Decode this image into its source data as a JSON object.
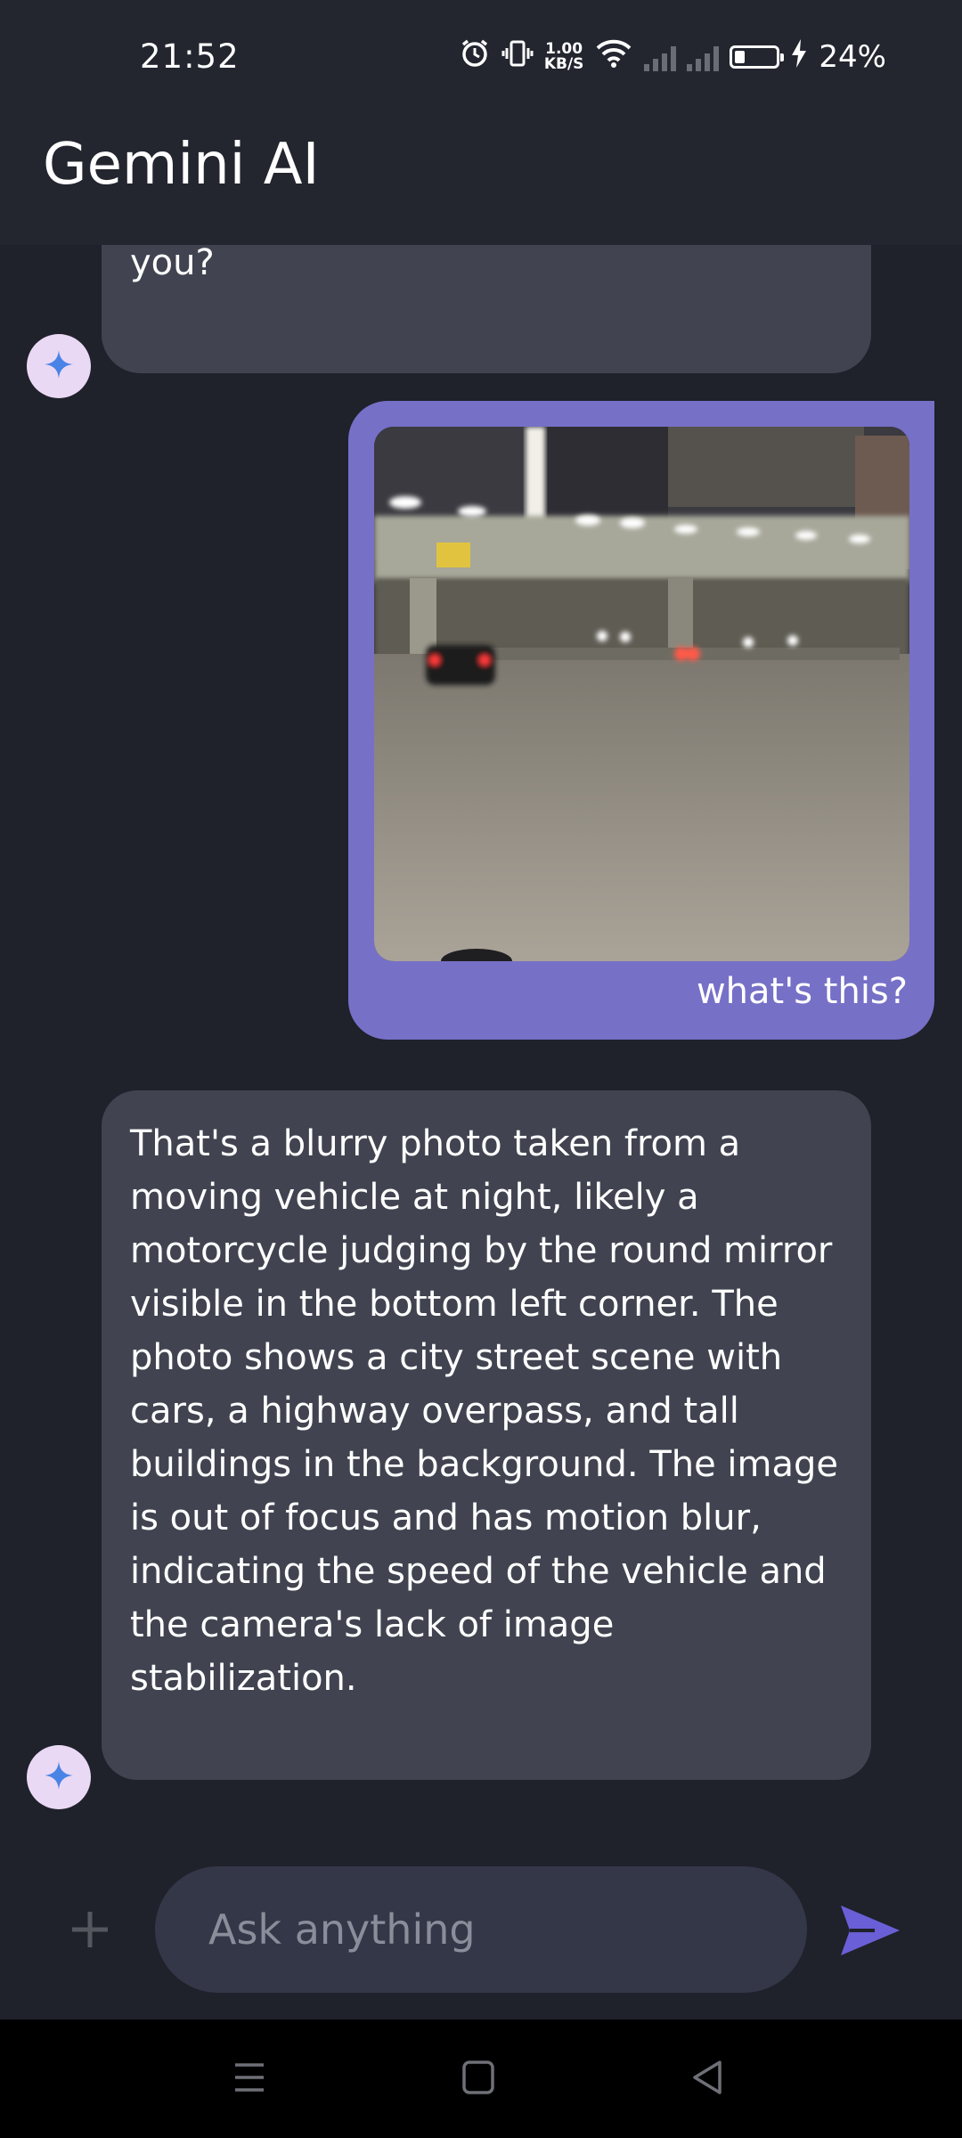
{
  "status_bar": {
    "time": "21:52",
    "net_speed_value": "1.00",
    "net_speed_unit": "KB/S",
    "battery": "24%",
    "battery_level": 0.24,
    "icons": [
      "alarm-icon",
      "vibrate-icon",
      "wifi-icon",
      "signal-icon",
      "signal-icon",
      "battery-icon",
      "charging-icon"
    ]
  },
  "header": {
    "title": "Gemini AI"
  },
  "messages": [
    {
      "role": "ai",
      "text": "you?"
    },
    {
      "role": "user",
      "text": "what's this?"
    },
    {
      "role": "ai",
      "text": "That's a blurry photo taken from a moving vehicle at night, likely a motorcycle judging by the round mirror visible in the bottom left corner.  The photo shows a city street scene with cars, a highway overpass, and tall buildings in the background.  The image is out of focus and has motion blur, indicating the speed of the vehicle and the camera's lack of image stabilization."
    }
  ],
  "input": {
    "placeholder": "Ask anything",
    "value": ""
  },
  "colors": {
    "accent": "#7670c7",
    "ai_bubble": "#414450",
    "background": "#1f212b",
    "send": "#6a5fd6"
  }
}
